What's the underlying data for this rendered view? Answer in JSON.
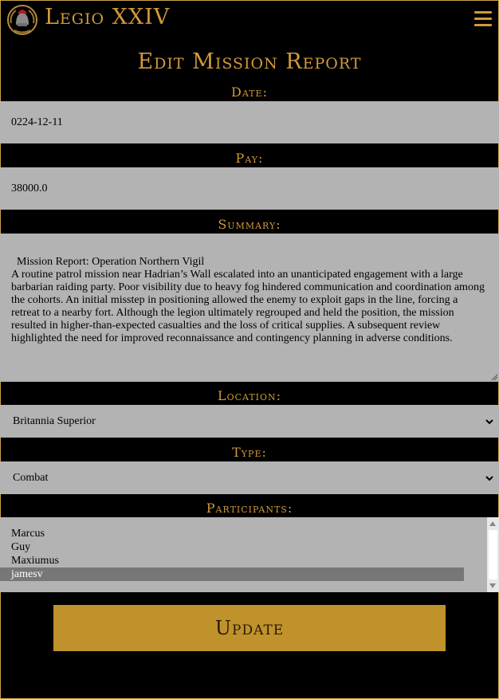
{
  "header": {
    "brand": "Legio XXIV",
    "logo_icon": "roman-helmet-laurel-icon",
    "menu_icon": "hamburger-menu-icon"
  },
  "page": {
    "title": "Edit Mission Report"
  },
  "form": {
    "date": {
      "label": "Date:",
      "value": "0224-12-11"
    },
    "pay": {
      "label": "Pay:",
      "value": "38000.0"
    },
    "summary": {
      "label": "Summary:",
      "value": "Mission Report: Operation Northern Vigil\nA routine patrol mission near Hadrian’s Wall escalated into an unanticipated engagement with a large barbarian raiding party. Poor visibility due to heavy fog hindered communication and coordination among the cohorts. An initial misstep in positioning allowed the enemy to exploit gaps in the line, forcing a retreat to a nearby fort. Although the legion ultimately regrouped and held the position, the mission resulted in higher-than-expected casualties and the loss of critical supplies. A subsequent review highlighted the need for improved reconnaissance and contingency planning in adverse conditions."
    },
    "location": {
      "label": "Location:",
      "value": "Britannia Superior"
    },
    "type": {
      "label": "Type:",
      "value": "Combat"
    },
    "participants": {
      "label": "Participants:",
      "options": [
        "Marcus",
        "Guy",
        "Maxiumus",
        "jamesv"
      ],
      "selected": "jamesv"
    },
    "submit_label": "Update"
  },
  "colors": {
    "background": "#000000",
    "accent_gold": "#d19a3a",
    "button_gold": "#c0922b",
    "field_gray": "#b3b3b3",
    "selected_option": "#777777"
  }
}
